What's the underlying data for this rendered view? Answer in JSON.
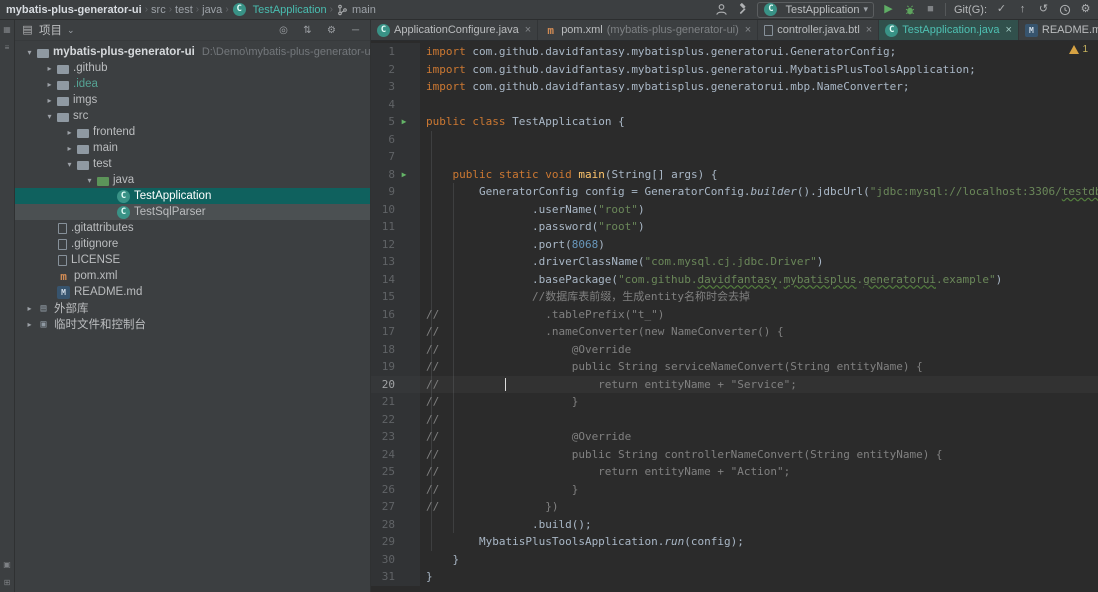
{
  "titlebar": {
    "breadcrumbs": [
      {
        "label": "mybatis-plus-generator-ui",
        "style": "bold"
      },
      {
        "label": "src"
      },
      {
        "label": "test"
      },
      {
        "label": "java"
      },
      {
        "label": "TestApplication",
        "icon": "class",
        "style": "accent"
      },
      {
        "label": "main",
        "icon": "branch"
      }
    ],
    "actions_left": [
      "user-icon",
      "build-hammer-icon"
    ],
    "run_config": "TestApplication",
    "actions_run": [
      "run-button",
      "debug-button",
      "stop-button"
    ],
    "git_label": "Git(G):",
    "actions_git": [
      "commit-check-icon",
      "push-up-icon",
      "rollback-icon",
      "history-icon",
      "settings-gear-icon"
    ]
  },
  "stripe": {
    "top": [
      "project-stripe-icon",
      "structure-stripe-icon"
    ],
    "bottom": [
      "version-control-stripe-icon",
      "terminal-stripe-icon"
    ]
  },
  "project_panel": {
    "title": "项目",
    "header_icons": [
      "locate-icon",
      "collapse-all-icon",
      "settings-icon",
      "hide-icon"
    ]
  },
  "tabs": [
    {
      "label": "ApplicationConfigure.java",
      "icon": "class"
    },
    {
      "label": "pom.xml",
      "suffix": "(mybatis-plus-generator-ui)",
      "icon": "maven"
    },
    {
      "label": "controller.java.btl",
      "icon": "file"
    },
    {
      "label": "TestApplication.java",
      "icon": "class",
      "active": true
    },
    {
      "label": "README.md",
      "icon": "markdown"
    }
  ],
  "tree": [
    {
      "depth": 0,
      "arrow": "open",
      "icon": "folder",
      "label": "mybatis-plus-generator-ui",
      "extra": "D:\\Demo\\mybatis-plus-generator-ui",
      "bold": true
    },
    {
      "depth": 1,
      "arrow": "closed",
      "icon": "folder",
      "label": ".github"
    },
    {
      "depth": 1,
      "arrow": "closed",
      "icon": "folder",
      "label": ".idea",
      "teal": true
    },
    {
      "depth": 1,
      "arrow": "closed",
      "icon": "folder",
      "label": "imgs"
    },
    {
      "depth": 1,
      "arrow": "open",
      "icon": "folder",
      "label": "src"
    },
    {
      "depth": 2,
      "arrow": "closed",
      "icon": "folder",
      "label": "frontend"
    },
    {
      "depth": 2,
      "arrow": "closed",
      "icon": "folder",
      "label": "main"
    },
    {
      "depth": 2,
      "arrow": "open",
      "icon": "folder",
      "label": "test"
    },
    {
      "depth": 3,
      "arrow": "open",
      "icon": "folder-green",
      "label": "java"
    },
    {
      "depth": 4,
      "icon": "class",
      "label": "TestApplication",
      "state": "selected"
    },
    {
      "depth": 4,
      "icon": "class",
      "label": "TestSqlParser",
      "state": "focused"
    },
    {
      "depth": 1,
      "icon": "file",
      "label": ".gitattributes"
    },
    {
      "depth": 1,
      "icon": "file",
      "label": ".gitignore"
    },
    {
      "depth": 1,
      "icon": "file",
      "label": "LICENSE"
    },
    {
      "depth": 1,
      "icon": "maven",
      "label": "pom.xml"
    },
    {
      "depth": 1,
      "icon": "markdown",
      "label": "README.md"
    },
    {
      "depth": 0,
      "arrow": "closed",
      "icon": "library",
      "label": "外部库"
    },
    {
      "depth": 0,
      "arrow": "closed",
      "icon": "console",
      "label": "临时文件和控制台"
    }
  ],
  "editor": {
    "warning_count": "1",
    "current_line": 20,
    "cursor_col": 12,
    "lines": [
      {
        "n": 1,
        "t": [
          [
            "kw",
            "import"
          ],
          [
            "pln",
            " com.github.davidfantasy.mybatisplus.generatorui.GeneratorConfig;"
          ]
        ]
      },
      {
        "n": 2,
        "t": [
          [
            "kw",
            "import"
          ],
          [
            "pln",
            " com.github.davidfantasy.mybatisplus.generatorui.MybatisPlusToolsApplication;"
          ]
        ]
      },
      {
        "n": 3,
        "t": [
          [
            "kw",
            "import"
          ],
          [
            "pln",
            " com.github.davidfantasy.mybatisplus.generatorui.mbp.NameConverter;"
          ]
        ]
      },
      {
        "n": 4,
        "t": []
      },
      {
        "n": 5,
        "g": "run",
        "t": [
          [
            "kw",
            "public"
          ],
          [
            "pln",
            " "
          ],
          [
            "kw",
            "class"
          ],
          [
            "pln",
            " TestApplication {"
          ]
        ]
      },
      {
        "n": 6,
        "t": []
      },
      {
        "n": 7,
        "t": []
      },
      {
        "n": 8,
        "g": "run",
        "t": [
          [
            "pln",
            "    "
          ],
          [
            "kw",
            "public"
          ],
          [
            "pln",
            " "
          ],
          [
            "kw",
            "static"
          ],
          [
            "pln",
            " "
          ],
          [
            "kw",
            "void"
          ],
          [
            "pln",
            " "
          ],
          [
            "fn",
            "main"
          ],
          [
            "pln",
            "(String[] args) {"
          ]
        ]
      },
      {
        "n": 9,
        "t": [
          [
            "pln",
            "        GeneratorConfig config = GeneratorConfig."
          ],
          [
            "it",
            "builder"
          ],
          [
            "pln",
            "().jdbcUrl("
          ],
          [
            "str",
            "\"jdbc:mysql://localhost:3306/"
          ],
          [
            "stru",
            "testdb"
          ],
          [
            "str",
            "\""
          ],
          [
            "pln",
            ")"
          ]
        ]
      },
      {
        "n": 10,
        "t": [
          [
            "pln",
            "                .userName("
          ],
          [
            "str",
            "\"root\""
          ],
          [
            "pln",
            ")"
          ]
        ]
      },
      {
        "n": 11,
        "t": [
          [
            "pln",
            "                .password("
          ],
          [
            "str",
            "\"root\""
          ],
          [
            "pln",
            ")"
          ]
        ]
      },
      {
        "n": 12,
        "t": [
          [
            "pln",
            "                .port("
          ],
          [
            "num",
            "8068"
          ],
          [
            "pln",
            ")"
          ]
        ]
      },
      {
        "n": 13,
        "t": [
          [
            "pln",
            "                .driverClassName("
          ],
          [
            "str",
            "\"com.mysql.cj.jdbc.Driver\""
          ],
          [
            "pln",
            ")"
          ]
        ]
      },
      {
        "n": 14,
        "t": [
          [
            "pln",
            "                .basePackage("
          ],
          [
            "str",
            "\"com.github."
          ],
          [
            "stru",
            "davidfantasy"
          ],
          [
            "str",
            "."
          ],
          [
            "stru",
            "mybatisplus"
          ],
          [
            "str",
            "."
          ],
          [
            "stru",
            "generatorui"
          ],
          [
            "str",
            ".example\""
          ],
          [
            "pln",
            ")"
          ]
        ]
      },
      {
        "n": 15,
        "t": [
          [
            "pln",
            "                "
          ],
          [
            "cmt",
            "//数据库表前缀，生成entity名称时会去掉"
          ]
        ]
      },
      {
        "n": 16,
        "t": [
          [
            "cmt",
            "//                .tablePrefix(\"t_\")"
          ]
        ]
      },
      {
        "n": 17,
        "t": [
          [
            "cmt",
            "//                .nameConverter(new NameConverter() {"
          ]
        ]
      },
      {
        "n": 18,
        "t": [
          [
            "cmt",
            "//                    @Override"
          ]
        ]
      },
      {
        "n": 19,
        "t": [
          [
            "cmt",
            "//                    public String serviceNameConvert(String entityName) {"
          ]
        ]
      },
      {
        "n": 20,
        "t": [
          [
            "cmt",
            "//                        return entityName + \"Service\";"
          ]
        ]
      },
      {
        "n": 21,
        "t": [
          [
            "cmt",
            "//                    }"
          ]
        ]
      },
      {
        "n": 22,
        "t": [
          [
            "cmt",
            "//"
          ]
        ]
      },
      {
        "n": 23,
        "t": [
          [
            "cmt",
            "//                    @Override"
          ]
        ]
      },
      {
        "n": 24,
        "t": [
          [
            "cmt",
            "//                    public String controllerNameConvert(String entityName) {"
          ]
        ]
      },
      {
        "n": 25,
        "t": [
          [
            "cmt",
            "//                        return entityName + \"Action\";"
          ]
        ]
      },
      {
        "n": 26,
        "t": [
          [
            "cmt",
            "//                    }"
          ]
        ]
      },
      {
        "n": 27,
        "t": [
          [
            "cmt",
            "//                })"
          ]
        ]
      },
      {
        "n": 28,
        "t": [
          [
            "pln",
            "                .build();"
          ]
        ]
      },
      {
        "n": 29,
        "t": [
          [
            "pln",
            "        MybatisPlusToolsApplication."
          ],
          [
            "it",
            "run"
          ],
          [
            "pln",
            "(config);"
          ]
        ]
      },
      {
        "n": 30,
        "t": [
          [
            "pln",
            "    }"
          ]
        ]
      },
      {
        "n": 31,
        "t": [
          [
            "pln",
            "}"
          ]
        ]
      }
    ]
  }
}
